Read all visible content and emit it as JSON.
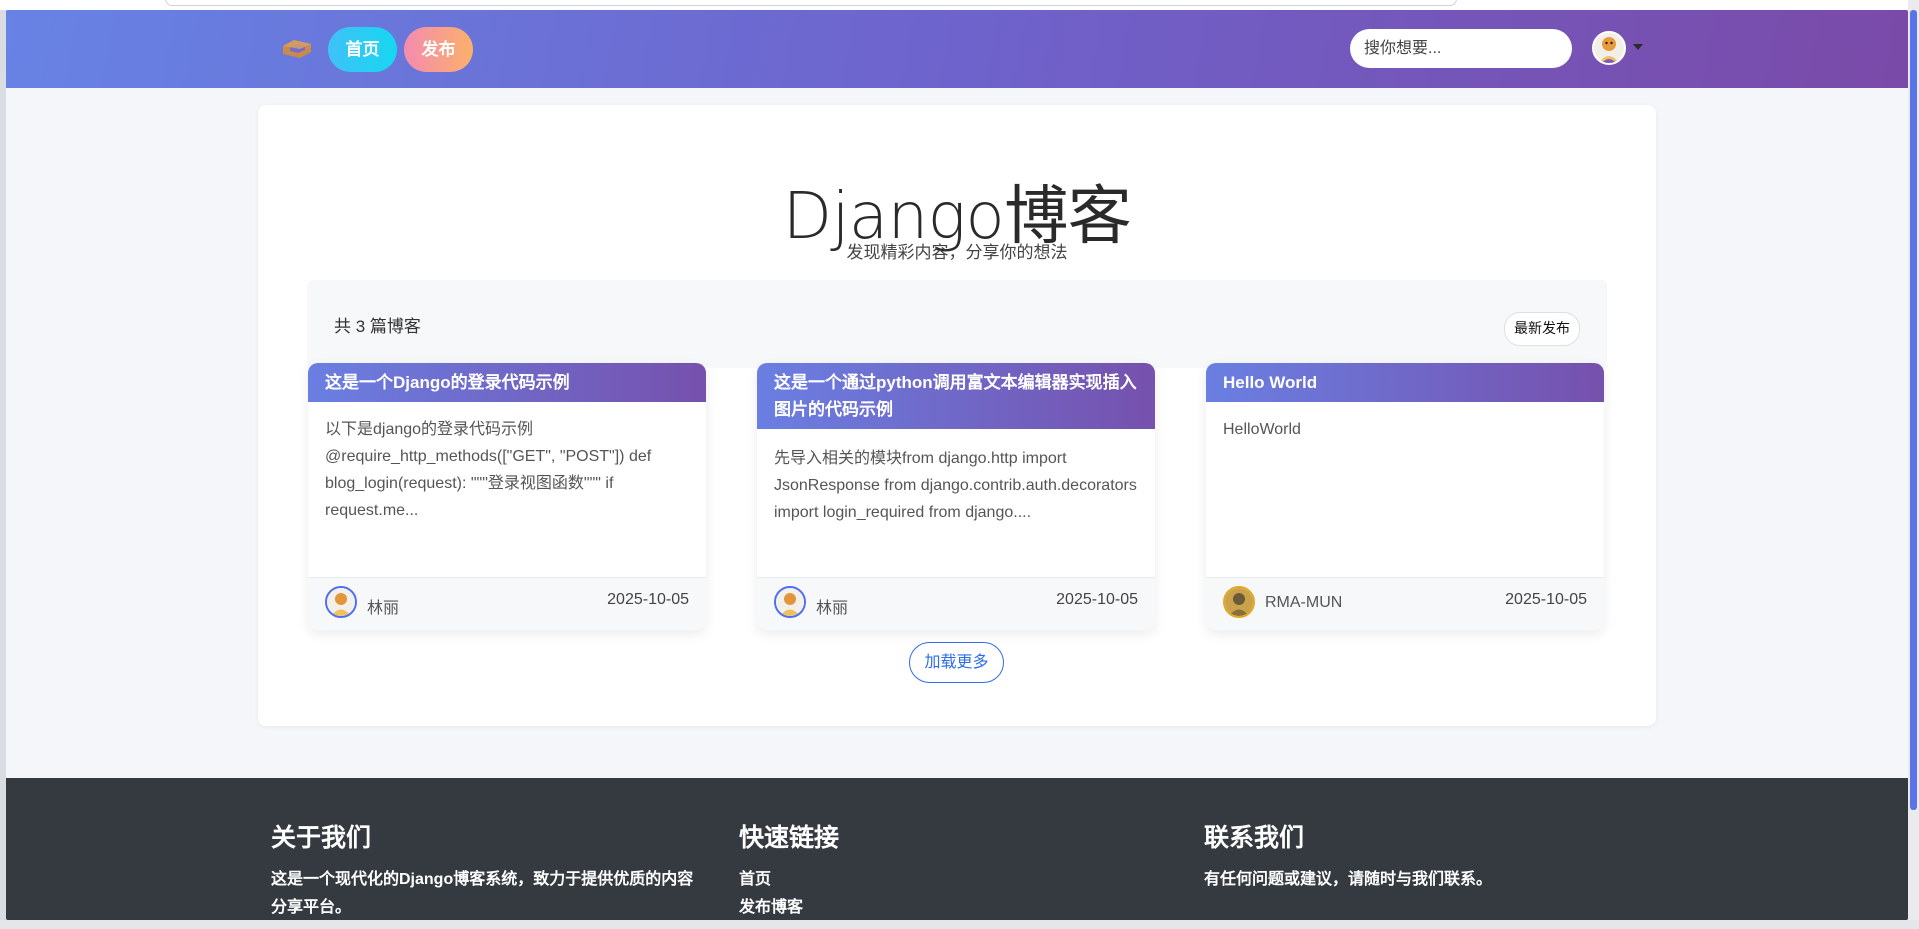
{
  "colors": {
    "navbar_gradient_start": "#6783e4",
    "navbar_gradient_end": "#7a4aa8",
    "home_button": "#17d7f0",
    "publish_button": "#fbb06a",
    "card_header_start": "#6a7fe2",
    "card_header_end": "#7651ad",
    "footer_bg": "#343a40",
    "load_more": "#2f6de6"
  },
  "navbar": {
    "logo_icon": "cube-logo-icon",
    "home_label": "首页",
    "publish_label": "发布",
    "search_placeholder": "搜你想要...",
    "user_avatar_icon": "user-avatar-icon",
    "caret_icon": "caret-down-icon"
  },
  "hero": {
    "title": "Django博客",
    "subtitle": "发现精彩内容，分享你的想法"
  },
  "list": {
    "count_text": "共 3 篇博客",
    "sort_label": "最新发布",
    "load_more_label": "加载更多"
  },
  "posts": [
    {
      "title": "这是一个Django的登录代码示例",
      "excerpt": "以下是django的登录代码示例 @require_http_methods([\"GET\", \"POST\"]) def blog_login(request): \"\"\"登录视图函数\"\"\" if request.me...",
      "author": "林丽",
      "date": "2025-10-05"
    },
    {
      "title": "这是一个通过python调用富文本编辑器实现插入图片的代码示例",
      "excerpt": "先导入相关的模块from django.http import JsonResponse from django.contrib.auth.decorators import login_required from django....",
      "author": "林丽",
      "date": "2025-10-05"
    },
    {
      "title": "Hello World",
      "excerpt": "HelloWorld",
      "author": "RMA-MUN",
      "date": "2025-10-05"
    }
  ],
  "footer": {
    "about_title": "关于我们",
    "about_text": "这是一个现代化的Django博客系统，致力于提供优质的内容分享平台。",
    "links_title": "快速链接",
    "link_home": "首页",
    "link_publish": "发布博客",
    "contact_title": "联系我们",
    "contact_text": "有任何问题或建议，请随时与我们联系。"
  }
}
